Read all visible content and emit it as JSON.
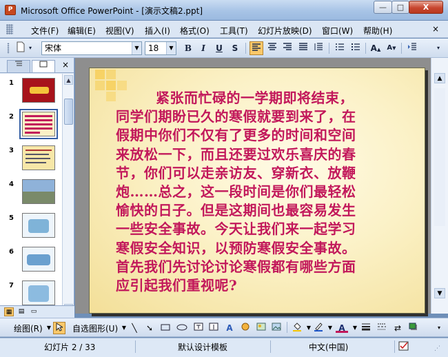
{
  "window": {
    "title": "Microsoft Office PowerPoint - [演示文稿2.ppt]",
    "app_icon_text": "P",
    "minimize": "—",
    "maximize": "□",
    "close": "X"
  },
  "menu": {
    "items": [
      "文件(F)",
      "编辑(E)",
      "视图(V)",
      "插入(I)",
      "格式(O)",
      "工具(T)",
      "幻灯片放映(D)",
      "窗口(W)",
      "帮助(H)"
    ],
    "close": "×"
  },
  "toolbar": {
    "font_name": "宋体",
    "font_size": "18",
    "bold": "B",
    "italic": "I",
    "underline": "U",
    "shadow": "S"
  },
  "left_pane": {
    "close": "×",
    "selected_slide": 2,
    "slide_numbers": [
      "1",
      "2",
      "3",
      "4",
      "5",
      "6",
      "7"
    ]
  },
  "slide": {
    "paragraph_lines": [
      "紧张而忙碌的一学期即将结束，",
      "同学们期盼已久的寒假就要到来了，在",
      "假期中你们不仅有了更多的时间和空间",
      "来放松一下，而且还要过欢乐喜庆的春",
      "节，你们可以走亲访友、穿新衣、放鞭",
      "炮……总之，这一段时间是你们最轻松",
      "愉快的日子。但是这期间也最容易发生",
      "一些安全事故。今天让我们来一起学习",
      "寒假安全知识，以预防寒假安全事故。",
      "首先我们先讨论讨论寒假都有哪些方面",
      "应引起我们重视呢?"
    ],
    "text_color": "#c2185b"
  },
  "drawing_toolbar": {
    "draw_label": "绘图(R)",
    "autoshapes_label": "自选图形(U)"
  },
  "status": {
    "slide_info": "幻灯片 2 / 33",
    "design": "默认设计模板",
    "language": "中文(中国)"
  }
}
